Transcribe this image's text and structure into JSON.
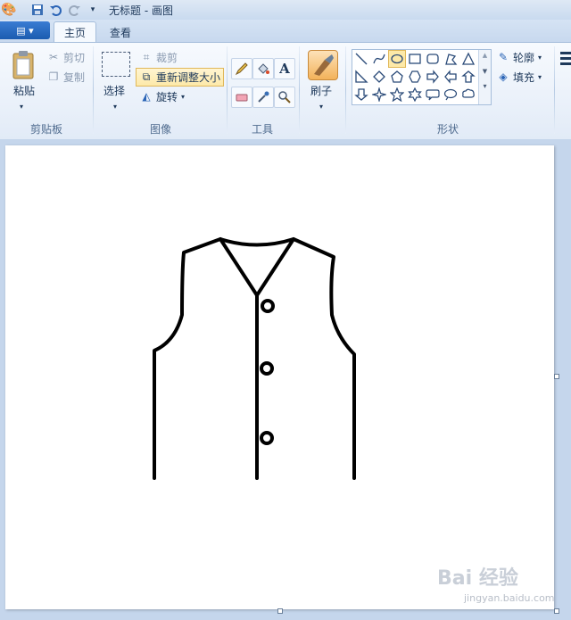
{
  "window": {
    "title": "无标题 - 画图"
  },
  "tabs": [
    {
      "label": "主页"
    },
    {
      "label": "查看"
    }
  ],
  "clipboard": {
    "paste": "粘贴",
    "cut": "剪切",
    "copy": "复制",
    "group": "剪贴板"
  },
  "image": {
    "select": "选择",
    "crop": "裁剪",
    "resize": "重新调整大小",
    "rotate": "旋转",
    "group": "图像"
  },
  "tools": {
    "group": "工具"
  },
  "brushes": {
    "label": "刷子"
  },
  "shapes": {
    "outline": "轮廓",
    "fill": "填充",
    "group": "形状"
  },
  "colors": {
    "accent": "#1b5cb0",
    "highlight": "#fde9a8",
    "ribbon_bg": "#f0f5fb",
    "canvas_bg": "#c5d6ec"
  },
  "watermark": {
    "text": "Bai 经验",
    "sub": "jingyan.baidu.com"
  }
}
